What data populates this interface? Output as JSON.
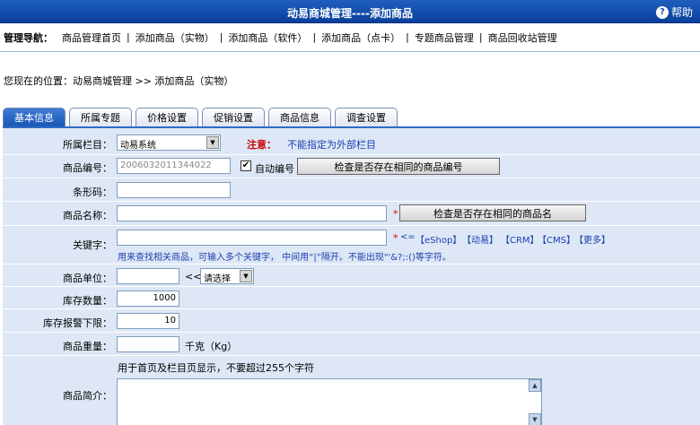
{
  "header": {
    "title": "动易商城管理----添加商品",
    "help_label": "帮助",
    "help_icon": "question-mark-icon"
  },
  "nav": {
    "label": "管理导航：",
    "links": [
      {
        "label": "商品管理首页"
      },
      {
        "label": "添加商品（实物）"
      },
      {
        "label": "添加商品（软件）"
      },
      {
        "label": "添加商品（点卡）"
      },
      {
        "label": "专题商品管理"
      },
      {
        "label": "商品回收站管理"
      }
    ],
    "separator": "|"
  },
  "location": {
    "text": "您现在的位置：动易商城管理 >> 添加商品（实物）"
  },
  "tabs": [
    {
      "label": "基本信息",
      "active": true
    },
    {
      "label": "所属专题"
    },
    {
      "label": "价格设置"
    },
    {
      "label": "促销设置"
    },
    {
      "label": "商品信息"
    },
    {
      "label": "调查设置"
    }
  ],
  "form": {
    "category": {
      "label": "所属栏目：",
      "value": "动易系统",
      "warn_label": "注意：",
      "warn_text": "不能指定为外部栏目"
    },
    "product_code": {
      "label": "商品编号：",
      "value": "20060320113440​22",
      "auto_label": "自动编号",
      "auto_checked": "✔",
      "check_button": "检查是否存在相同的商品编号"
    },
    "barcode": {
      "label": "条形码：",
      "value": ""
    },
    "product_name": {
      "label": "商品名称：",
      "value": "",
      "required": "*",
      "check_button": "检查是否存在相同的商品名"
    },
    "keywords": {
      "label": "关键字：",
      "value": "",
      "required": "*",
      "quick_prefix": "<=",
      "quick_links": [
        "【eShop】",
        "【动易】",
        "【CRM】",
        "【CMS】",
        "【更多】"
      ],
      "hint": "用来查找相关商品，可输入多个关键字， 中间用“|”隔开。不能出现\"'&?;:()等字符。"
    },
    "unit": {
      "label": "商品单位：",
      "value": "",
      "arrow": "<<",
      "select_value": "请选择"
    },
    "stock": {
      "label": "库存数量：",
      "value": "1000"
    },
    "stock_alert": {
      "label": "库存报警下限：",
      "value": "10"
    },
    "weight": {
      "label": "商品重量：",
      "value": "",
      "unit": "千克（Kg）"
    },
    "intro": {
      "label": "商品简介：",
      "hint": "用于首页及栏目页显示，不要超过255个字符",
      "value": ""
    }
  }
}
